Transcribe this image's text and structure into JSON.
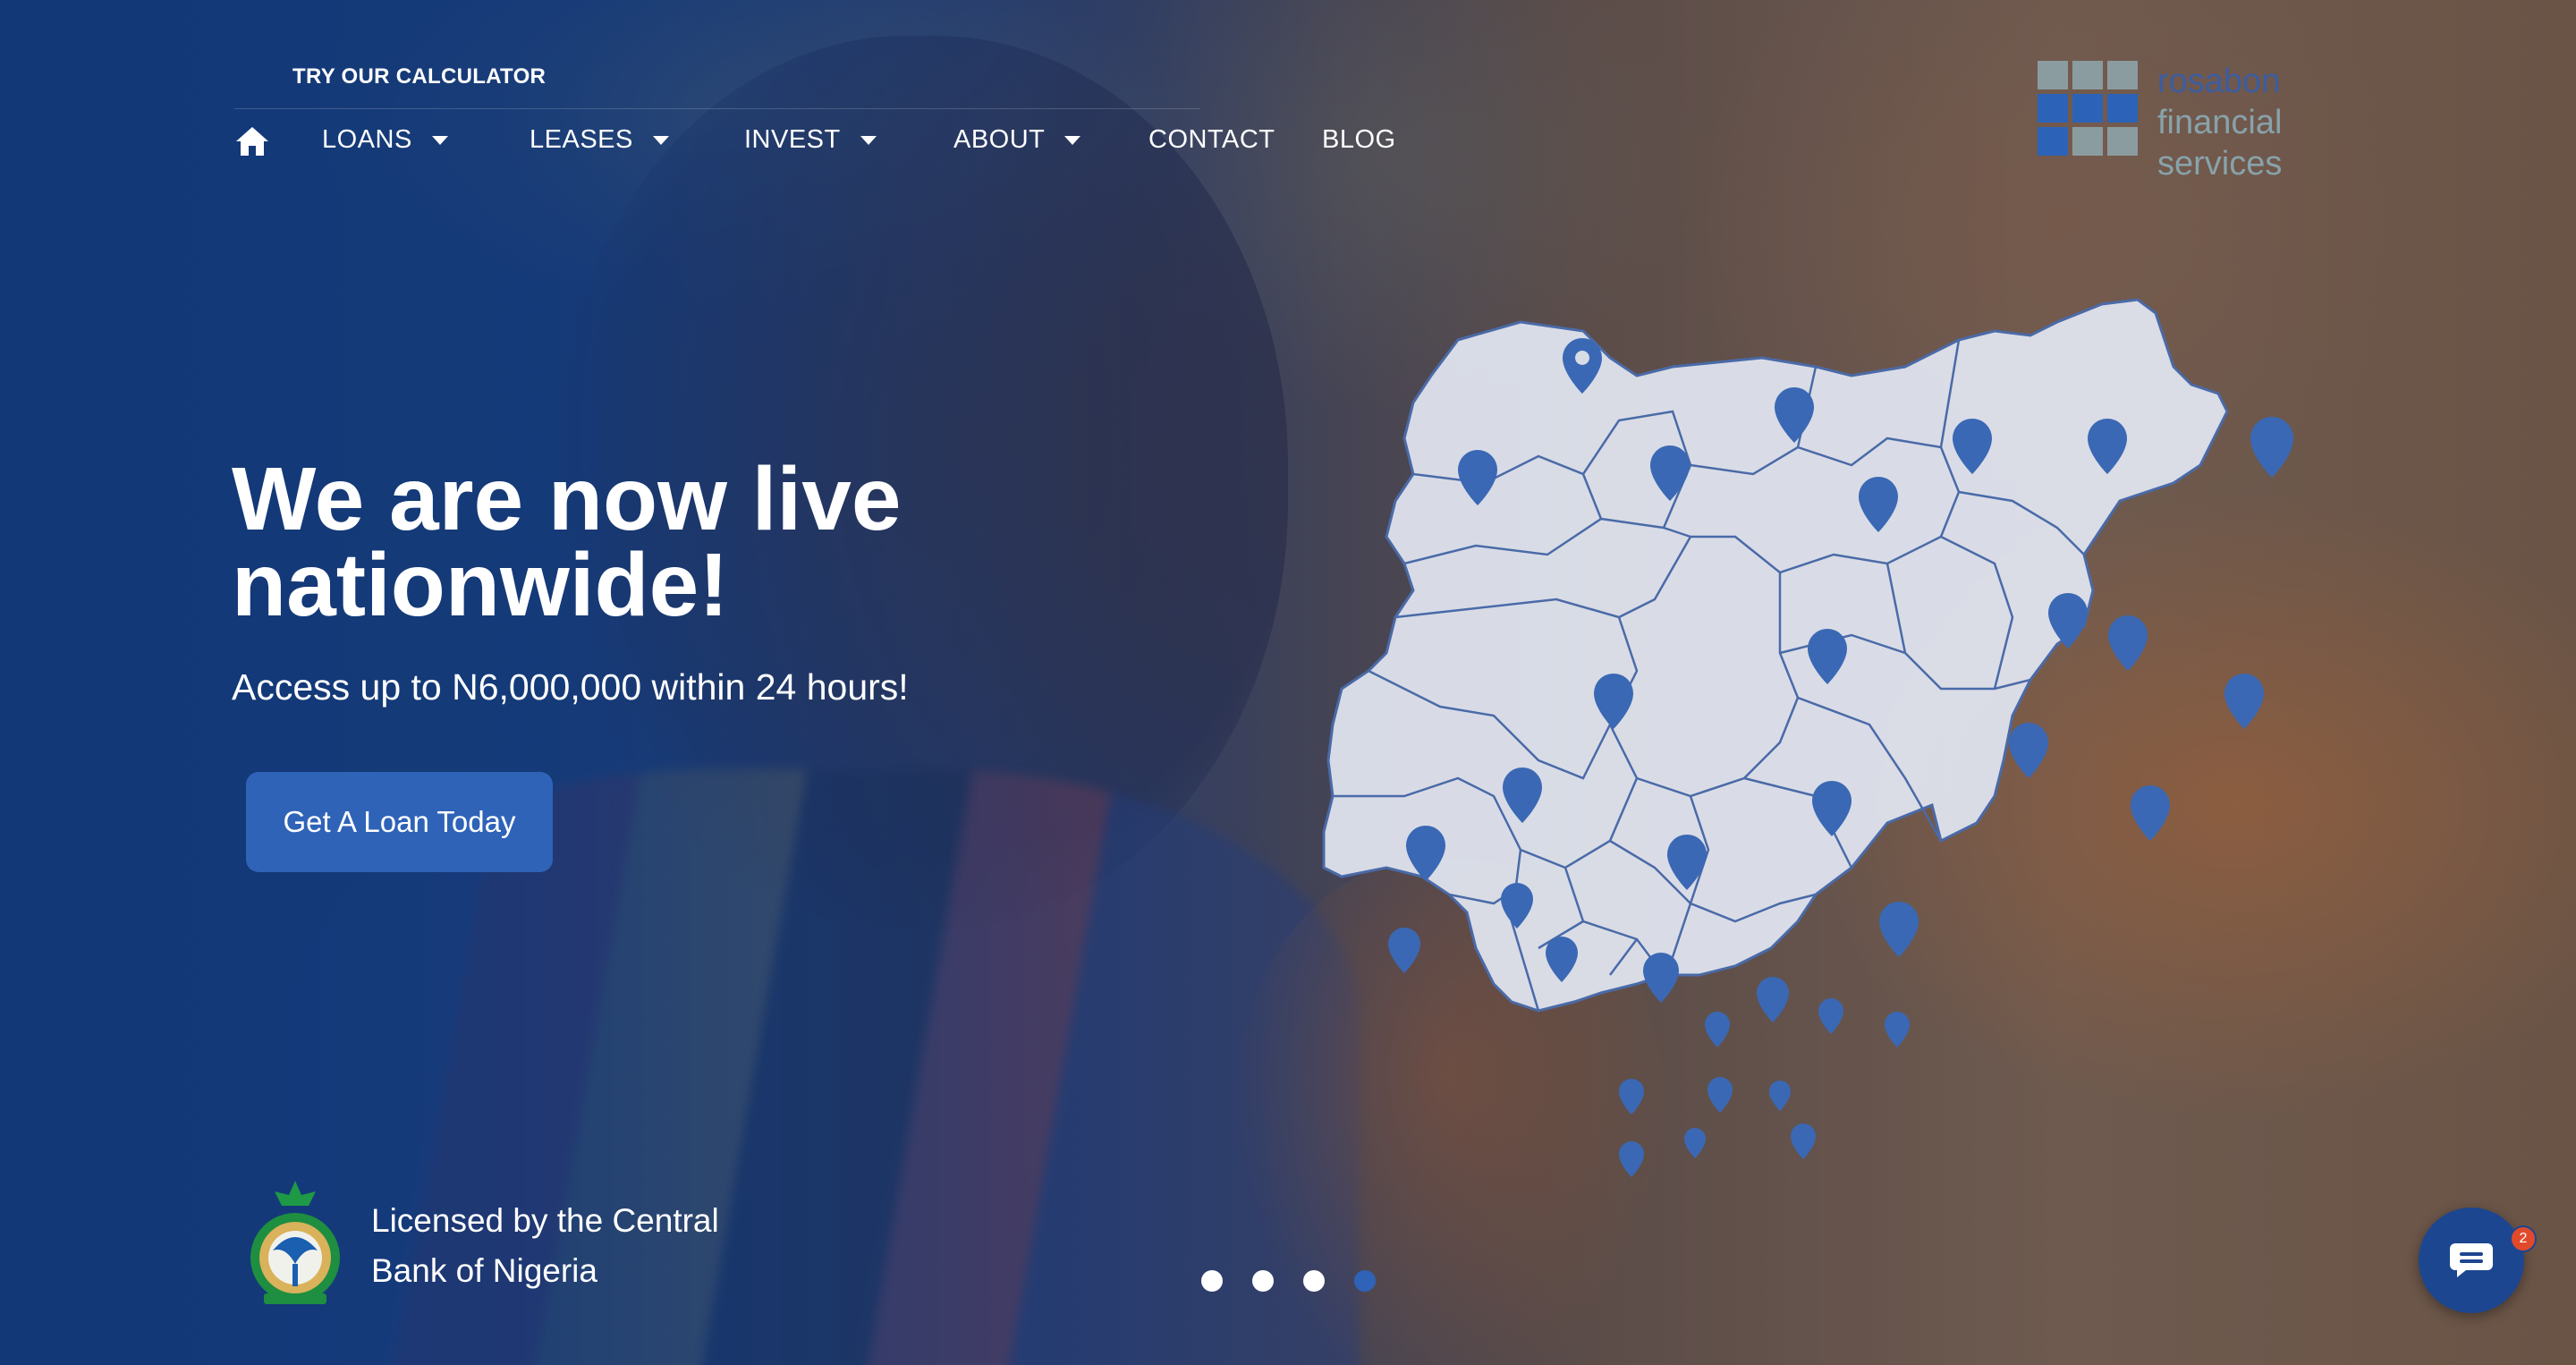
{
  "topbar": {
    "calculator_link": "TRY OUR CALCULATOR"
  },
  "nav": {
    "home_icon": "home-icon",
    "items": [
      {
        "label": "LOANS",
        "has_dropdown": true
      },
      {
        "label": "LEASES",
        "has_dropdown": true
      },
      {
        "label": "INVEST",
        "has_dropdown": true
      },
      {
        "label": "ABOUT",
        "has_dropdown": true
      },
      {
        "label": "CONTACT",
        "has_dropdown": false
      },
      {
        "label": "BLOG",
        "has_dropdown": false
      }
    ]
  },
  "logo": {
    "line1": "rosabon",
    "line2": "financial",
    "line3": "services"
  },
  "hero": {
    "title_line1": "We are now live",
    "title_line2": "nationwide!",
    "subtitle": "Access up to N6,000,000 within 24 hours!",
    "cta_label": "Get A Loan Today"
  },
  "license": {
    "line1": "Licensed by the Central",
    "line2": "Bank of Nigeria",
    "seal_icon": "cbn-seal-icon"
  },
  "slider": {
    "count": 4,
    "active_index": 4
  },
  "chat": {
    "icon": "chat-icon",
    "badge_count": "2"
  },
  "colors": {
    "primary": "#2f63b8",
    "navy": "#1d4690",
    "map_fill": "#dfe4ee",
    "pin": "#3a68b4"
  }
}
